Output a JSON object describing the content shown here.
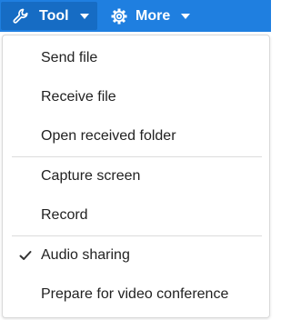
{
  "toolbar": {
    "tool_label": "Tool",
    "tool_icon": "wrench-icon",
    "more_label": "More",
    "more_icon": "gear-icon",
    "background_color": "#1f7fe0",
    "active_color": "#166cc4"
  },
  "menu": {
    "items": [
      {
        "label": "Send file",
        "checked": false
      },
      {
        "label": "Receive file",
        "checked": false
      },
      {
        "label": "Open received folder",
        "checked": false
      },
      {
        "label": "Capture screen",
        "checked": false
      },
      {
        "label": "Record",
        "checked": false
      },
      {
        "label": "Audio sharing",
        "checked": true
      },
      {
        "label": "Prepare for video conference",
        "checked": false
      }
    ]
  }
}
